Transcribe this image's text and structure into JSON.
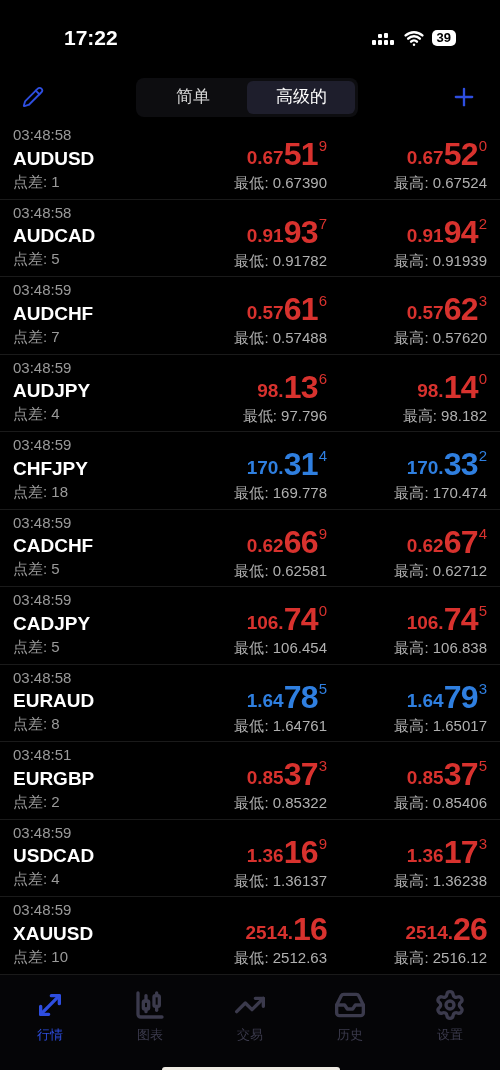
{
  "status_bar": {
    "time": "17:22",
    "battery": "39"
  },
  "header": {
    "segments": [
      {
        "label": "简单",
        "selected": false
      },
      {
        "label": "高级的",
        "selected": true
      }
    ]
  },
  "quotes": [
    {
      "time": "03:48:58",
      "symbol": "AUDUSD",
      "spread": "点差: 1",
      "color": "#d8322e",
      "bid": {
        "prefix": "0.67",
        "big": "51",
        "sup": "9"
      },
      "ask": {
        "prefix": "0.67",
        "big": "52",
        "sup": "0"
      },
      "low": "最低: 0.67390",
      "high": "最高: 0.67524"
    },
    {
      "time": "03:48:58",
      "symbol": "AUDCAD",
      "spread": "点差: 5",
      "color": "#d8322e",
      "bid": {
        "prefix": "0.91",
        "big": "93",
        "sup": "7"
      },
      "ask": {
        "prefix": "0.91",
        "big": "94",
        "sup": "2"
      },
      "low": "最低: 0.91782",
      "high": "最高: 0.91939"
    },
    {
      "time": "03:48:59",
      "symbol": "AUDCHF",
      "spread": "点差: 7",
      "color": "#d8322e",
      "bid": {
        "prefix": "0.57",
        "big": "61",
        "sup": "6"
      },
      "ask": {
        "prefix": "0.57",
        "big": "62",
        "sup": "3"
      },
      "low": "最低: 0.57488",
      "high": "最高: 0.57620"
    },
    {
      "time": "03:48:59",
      "symbol": "AUDJPY",
      "spread": "点差: 4",
      "color": "#d8322e",
      "bid": {
        "prefix": "98.",
        "big": "13",
        "sup": "6"
      },
      "ask": {
        "prefix": "98.",
        "big": "14",
        "sup": "0"
      },
      "low": "最低: 97.796",
      "high": "最高: 98.182"
    },
    {
      "time": "03:48:59",
      "symbol": "CHFJPY",
      "spread": "点差: 18",
      "color": "#2f7fe0",
      "bid": {
        "prefix": "170.",
        "big": "31",
        "sup": "4"
      },
      "ask": {
        "prefix": "170.",
        "big": "33",
        "sup": "2"
      },
      "low": "最低: 169.778",
      "high": "最高: 170.474"
    },
    {
      "time": "03:48:59",
      "symbol": "CADCHF",
      "spread": "点差: 5",
      "color": "#d8322e",
      "bid": {
        "prefix": "0.62",
        "big": "66",
        "sup": "9"
      },
      "ask": {
        "prefix": "0.62",
        "big": "67",
        "sup": "4"
      },
      "low": "最低: 0.62581",
      "high": "最高: 0.62712"
    },
    {
      "time": "03:48:59",
      "symbol": "CADJPY",
      "spread": "点差: 5",
      "color": "#d8322e",
      "bid": {
        "prefix": "106.",
        "big": "74",
        "sup": "0"
      },
      "ask": {
        "prefix": "106.",
        "big": "74",
        "sup": "5"
      },
      "low": "最低: 106.454",
      "high": "最高: 106.838"
    },
    {
      "time": "03:48:58",
      "symbol": "EURAUD",
      "spread": "点差: 8",
      "color": "#2f7fe0",
      "bid": {
        "prefix": "1.64",
        "big": "78",
        "sup": "5"
      },
      "ask": {
        "prefix": "1.64",
        "big": "79",
        "sup": "3"
      },
      "low": "最低: 1.64761",
      "high": "最高: 1.65017"
    },
    {
      "time": "03:48:51",
      "symbol": "EURGBP",
      "spread": "点差: 2",
      "color": "#d8322e",
      "bid": {
        "prefix": "0.85",
        "big": "37",
        "sup": "3"
      },
      "ask": {
        "prefix": "0.85",
        "big": "37",
        "sup": "5"
      },
      "low": "最低: 0.85322",
      "high": "最高: 0.85406"
    },
    {
      "time": "03:48:59",
      "symbol": "USDCAD",
      "spread": "点差: 4",
      "color": "#d8322e",
      "bid": {
        "prefix": "1.36",
        "big": "16",
        "sup": "9"
      },
      "ask": {
        "prefix": "1.36",
        "big": "17",
        "sup": "3"
      },
      "low": "最低: 1.36137",
      "high": "最高: 1.36238"
    },
    {
      "time": "03:48:59",
      "symbol": "XAUUSD",
      "spread": "点差: 10",
      "color": "#d8322e",
      "bid": {
        "prefix": "2514.",
        "big": "16"
      },
      "ask": {
        "prefix": "2514.",
        "big": "26"
      },
      "low": "最低: 2512.63",
      "high": "最高: 2516.12"
    }
  ],
  "tab_bar": [
    {
      "label": "行情",
      "kind": "quotes",
      "selected": true
    },
    {
      "label": "图表",
      "kind": "chart",
      "selected": false
    },
    {
      "label": "交易",
      "kind": "trade",
      "selected": false
    },
    {
      "label": "历史",
      "kind": "history",
      "selected": false
    },
    {
      "label": "设置",
      "kind": "settings",
      "selected": false
    }
  ]
}
